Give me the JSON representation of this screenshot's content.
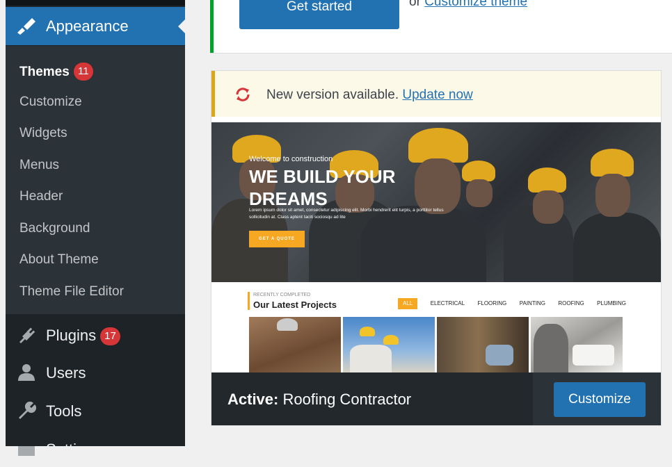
{
  "sidebar": {
    "appearance": {
      "label": "Appearance",
      "icon": "paintbrush-icon"
    },
    "submenu": [
      {
        "label": "Themes",
        "badge": "11",
        "current": true
      },
      {
        "label": "Customize"
      },
      {
        "label": "Widgets"
      },
      {
        "label": "Menus"
      },
      {
        "label": "Header"
      },
      {
        "label": "Background"
      },
      {
        "label": "About Theme"
      },
      {
        "label": "Theme File Editor"
      }
    ],
    "menu": [
      {
        "label": "Plugins",
        "badge": "17",
        "icon": "plugin-icon"
      },
      {
        "label": "Users",
        "icon": "users-icon"
      },
      {
        "label": "Tools",
        "icon": "wrench-icon"
      },
      {
        "label": "Settings",
        "icon": "settings-icon"
      }
    ]
  },
  "top_panel": {
    "button_label": "Get started",
    "or": "or",
    "link": "Customize theme"
  },
  "notice": {
    "text": "New version available.",
    "link": "Update now"
  },
  "theme_preview": {
    "welcome": "Welcome to construction",
    "headline": "WE BUILD YOUR DREAMS",
    "lorem": "Lorem ipsum dolor sit amet, consectetur adipiscing elit. Morbi hendrerit elit turpis, a porttitor tellus sollicitudin at. Class aptent taciti sociosqu ad lite",
    "quote_button": "GET A QUOTE",
    "recently": "RECENTLY COMPLETED",
    "projects_title": "Our Latest Projects",
    "filters": [
      "ALL",
      "ELECTRICAL",
      "FLOORING",
      "PAINTING",
      "ROOFING",
      "PLUMBING"
    ]
  },
  "footer": {
    "active_prefix": "Active:",
    "theme_name": "Roofing Contractor",
    "customize_label": "Customize"
  },
  "colors": {
    "sidebar_bg": "#1d2327",
    "accent": "#2271b1",
    "badge": "#d63638",
    "notice_border": "#dba617",
    "preview_accent": "#f7a823"
  }
}
